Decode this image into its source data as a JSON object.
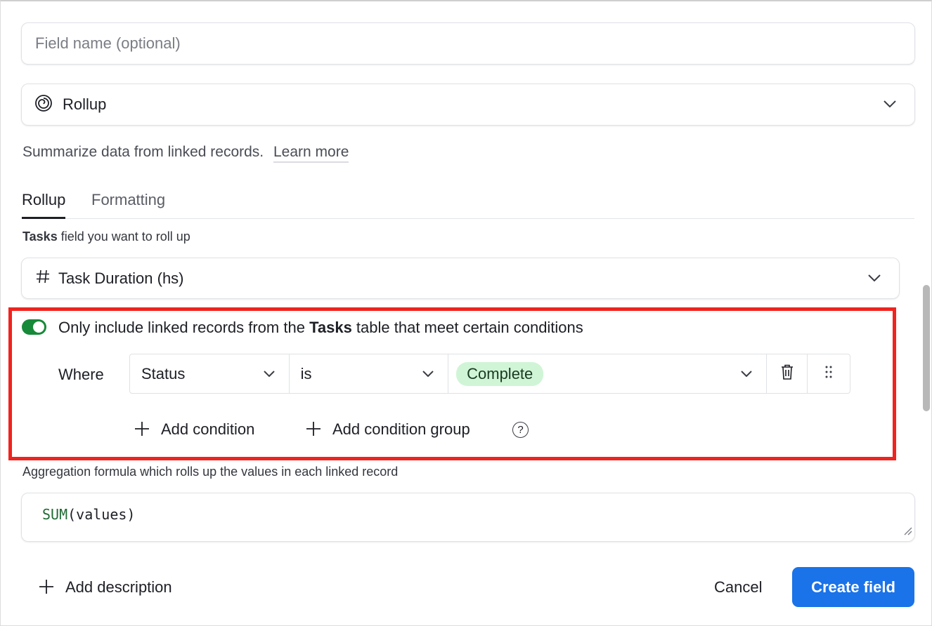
{
  "field_name": {
    "placeholder": "Field name (optional)",
    "value": ""
  },
  "field_type": {
    "label": "Rollup",
    "icon": "spiral-icon"
  },
  "description": {
    "text": "Summarize data from linked records.",
    "link": "Learn more"
  },
  "tabs": [
    {
      "label": "Rollup",
      "active": true
    },
    {
      "label": "Formatting",
      "active": false
    }
  ],
  "rollup_field_label": {
    "table": "Tasks",
    "rest": " field you want to roll up"
  },
  "rollup_field": {
    "label": "Task Duration (hs)",
    "icon": "hash-icon"
  },
  "conditions": {
    "toggle_on": true,
    "text_prefix": "Only include linked records from the ",
    "table": "Tasks",
    "text_suffix": " table that meet certain conditions",
    "where_label": "Where",
    "filter": {
      "field": "Status",
      "operator": "is",
      "value": "Complete"
    },
    "add_condition": "Add condition",
    "add_condition_group": "Add condition group",
    "help": "?"
  },
  "aggregation": {
    "label": "Aggregation formula which rolls up the values in each linked record",
    "formula_fn": "SUM",
    "formula_args": "(values)"
  },
  "footer": {
    "add_description": "Add description",
    "cancel": "Cancel",
    "create": "Create field"
  },
  "colors": {
    "accent": "#1a73e8",
    "toggle": "#168a38",
    "highlight": "#f0231e",
    "pill_bg": "#d0f5d6"
  }
}
